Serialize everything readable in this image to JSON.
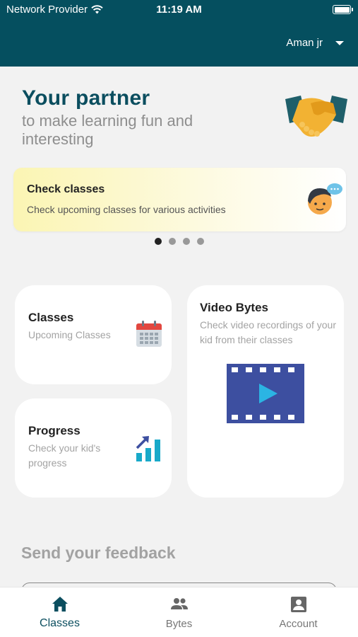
{
  "status_bar": {
    "carrier": "Network Provider",
    "time": "11:19 AM"
  },
  "header": {
    "user_name": "Aman jr"
  },
  "hero": {
    "title": "Your partner",
    "subtitle": "to make learning fun and interesting"
  },
  "banner": {
    "title": "Check classes",
    "description": "Check upcoming classes for various activities",
    "page_count": 4,
    "active_page": 0
  },
  "cards": {
    "classes": {
      "title": "Classes",
      "description": "Upcoming Classes",
      "icon": "calendar-icon"
    },
    "progress": {
      "title": "Progress",
      "description": "Check your kid's progress",
      "icon": "progress-chart-icon"
    },
    "video_bytes": {
      "title": "Video Bytes",
      "description": "Check video recordings of your kid from their classes",
      "icon": "video-film-icon"
    }
  },
  "feedback": {
    "title": "Send your feedback"
  },
  "tabbar": {
    "tabs": [
      {
        "label": "Classes",
        "icon": "home-icon",
        "active": true
      },
      {
        "label": "Bytes",
        "icon": "people-icon",
        "active": false
      },
      {
        "label": "Account",
        "icon": "account-icon",
        "active": false
      }
    ]
  },
  "colors": {
    "primary": "#054f5f",
    "active_tab": "#0b4e5f",
    "background": "#f2f2f2"
  }
}
